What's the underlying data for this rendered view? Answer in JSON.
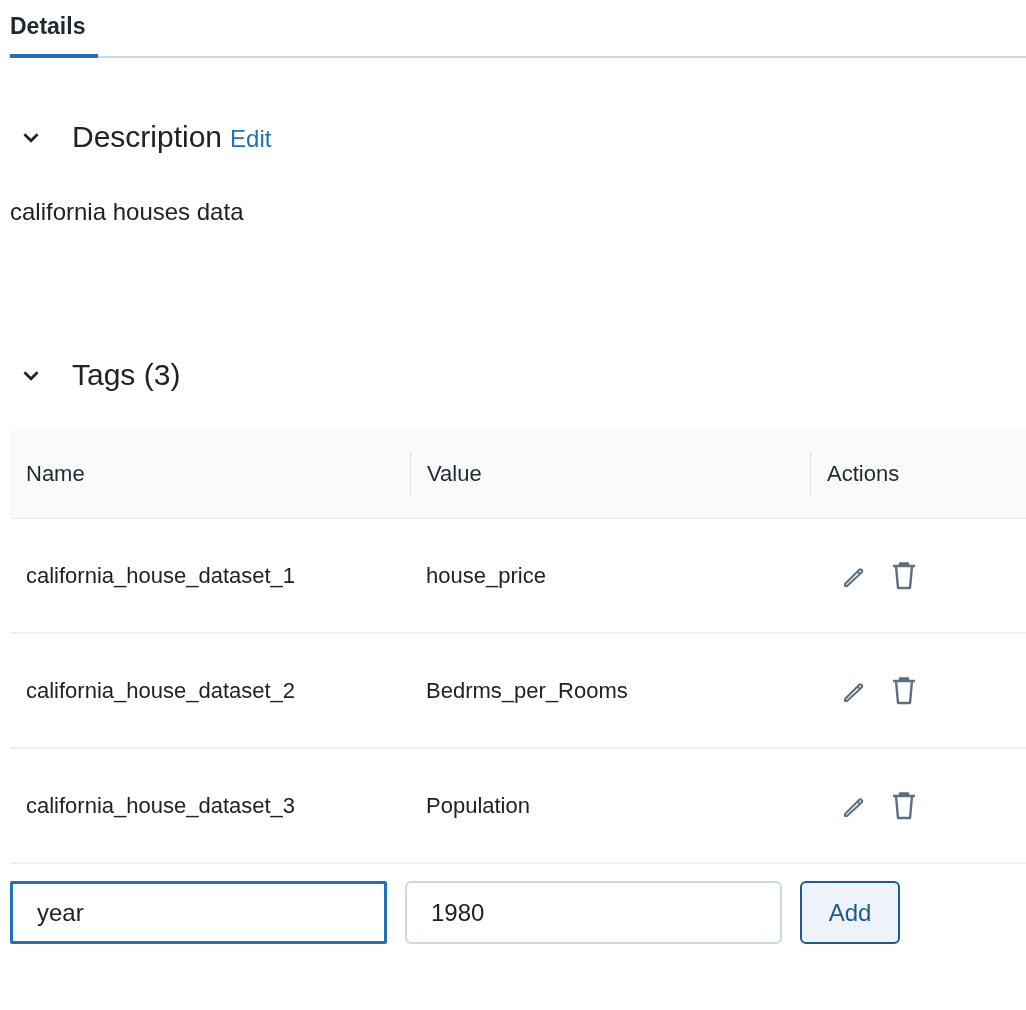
{
  "tabs": [
    {
      "label": "Details",
      "selected": true
    }
  ],
  "description": {
    "title": "Description",
    "expanded": true,
    "edit_link": "Edit",
    "text": "california houses data"
  },
  "tags": {
    "title": "Tags (3)",
    "expanded": true,
    "columns": [
      "Name",
      "Value",
      "Actions"
    ],
    "rows": [
      {
        "name": "california_house_dataset_1",
        "value": "house_price"
      },
      {
        "name": "california_house_dataset_2",
        "value": "Bedrms_per_Rooms"
      },
      {
        "name": "california_house_dataset_3",
        "value": "Population"
      }
    ],
    "new_tag": {
      "name": {
        "value": "year",
        "focused": true
      },
      "value": {
        "value": "1980",
        "focused": false
      },
      "button": "Add"
    }
  }
}
